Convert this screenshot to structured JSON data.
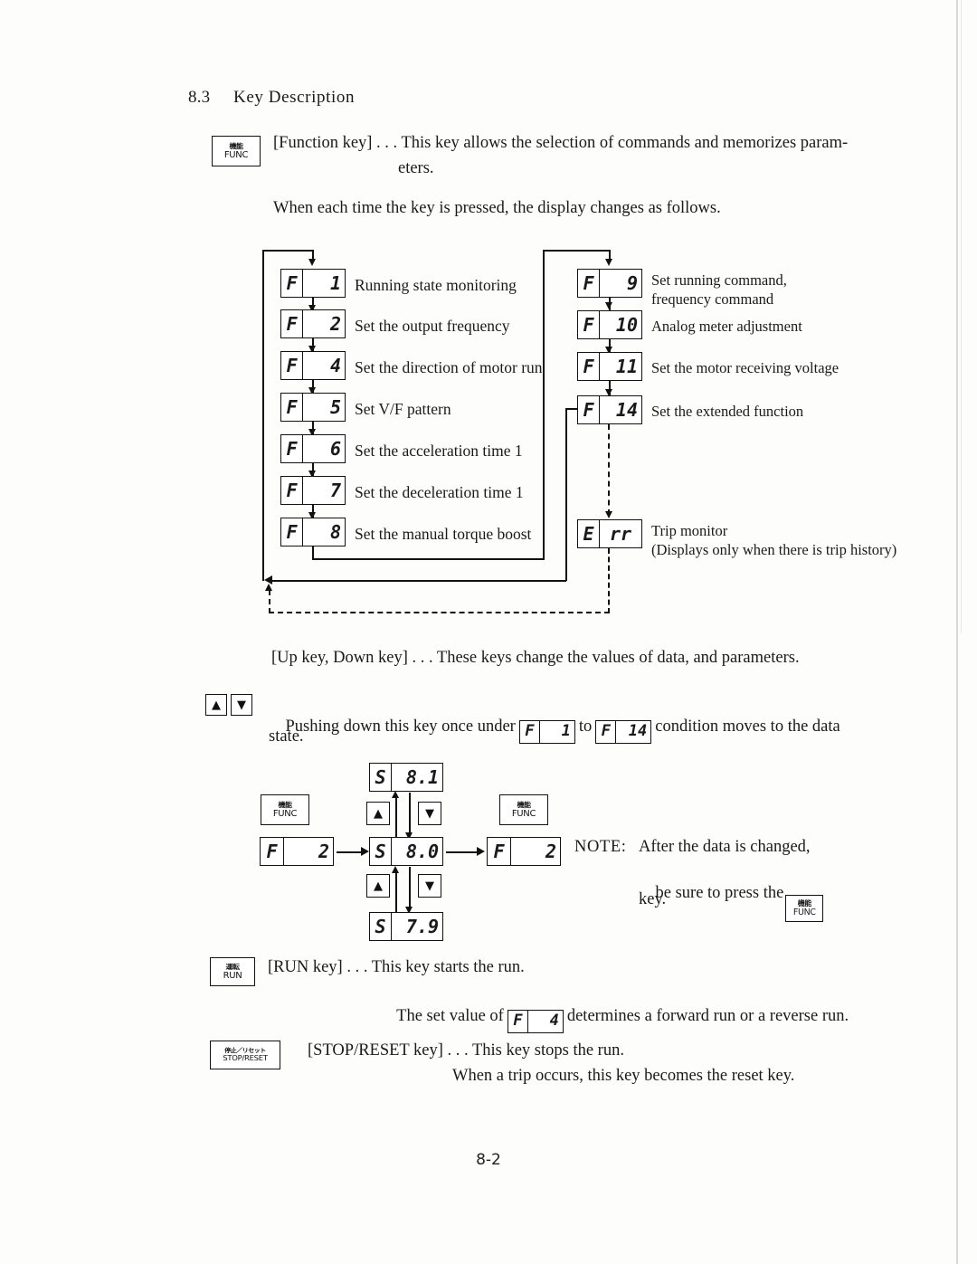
{
  "section": {
    "number": "8.3",
    "title": "Key Description"
  },
  "func_key_intro": {
    "key_jp": "機能",
    "key_en": "FUNC",
    "line1": "[Function key] . . . This key allows the selection of commands and memorizes param-",
    "line2": "eters.",
    "line3": "When each time the key is pressed, the display changes as follows."
  },
  "flowchart": {
    "left_column": [
      {
        "code_left": "F",
        "code_right": "1",
        "label": "Running state monitoring"
      },
      {
        "code_left": "F",
        "code_right": "2",
        "label": "Set the output frequency"
      },
      {
        "code_left": "F",
        "code_right": "4",
        "label": "Set the direction of motor run"
      },
      {
        "code_left": "F",
        "code_right": "5",
        "label": "Set V/F pattern"
      },
      {
        "code_left": "F",
        "code_right": "6",
        "label": "Set the acceleration time 1"
      },
      {
        "code_left": "F",
        "code_right": "7",
        "label": "Set the deceleration time 1"
      },
      {
        "code_left": "F",
        "code_right": "8",
        "label": "Set the manual torque boost"
      }
    ],
    "right_column": [
      {
        "code_left": "F",
        "code_right": "9",
        "label": "Set running command,",
        "label2": "frequency command"
      },
      {
        "code_left": "F",
        "code_right": "10",
        "label": "Analog meter adjustment",
        "label2": ""
      },
      {
        "code_left": "F",
        "code_right": "11",
        "label": "Set the motor receiving voltage",
        "label2": ""
      },
      {
        "code_left": "F",
        "code_right": "14",
        "label": "Set the extended function",
        "label2": ""
      }
    ],
    "trip": {
      "code_left": "E",
      "code_right": "rr",
      "label": "Trip monitor",
      "label2": "(Displays only when there is trip history)"
    }
  },
  "updown_key": {
    "line1": "[Up key, Down key] . . . These keys change the values of data, and parameters.",
    "up_glyph": "▲",
    "down_glyph": "▼",
    "sentence_a": "Pushing down this key once under",
    "seg_from": {
      "code_left": "F",
      "code_right": "1"
    },
    "sentence_b": "to",
    "seg_to": {
      "code_left": "F",
      "code_right": "14"
    },
    "sentence_c": "condition moves to the data",
    "sentence_d": "state."
  },
  "data_diagram": {
    "func_key_jp": "機能",
    "func_key_en": "FUNC",
    "up_glyph": "▲",
    "down_glyph": "▼",
    "seg_left": {
      "code_left": "F",
      "code_right": "2"
    },
    "seg_right": {
      "code_left": "F",
      "code_right": "2"
    },
    "seg_center": {
      "code_left": "S",
      "code_right": "8.0"
    },
    "seg_top": {
      "code_left": "S",
      "code_right": "8.1"
    },
    "seg_bottom": {
      "code_left": "S",
      "code_right": "7.9"
    },
    "note_label": "NOTE:",
    "note_line1": "After the data is changed,",
    "note_line2a": "be sure to press the",
    "note_line3": "key."
  },
  "run_key": {
    "key_jp": "運転",
    "key_en": "RUN",
    "line1": "[RUN key] . . . This key starts the run.",
    "line2a": "The set value of",
    "seg": {
      "code_left": "F",
      "code_right": "4"
    },
    "line2b": "determines a forward run or a reverse run."
  },
  "stop_key": {
    "key_jp": "停止／リセット",
    "key_en": "STOP/RESET",
    "line1": "[STOP/RESET key] . . . This key stops the run.",
    "line2": "When a trip occurs, this key becomes the reset key."
  },
  "footer": {
    "page_number": "8-2"
  }
}
